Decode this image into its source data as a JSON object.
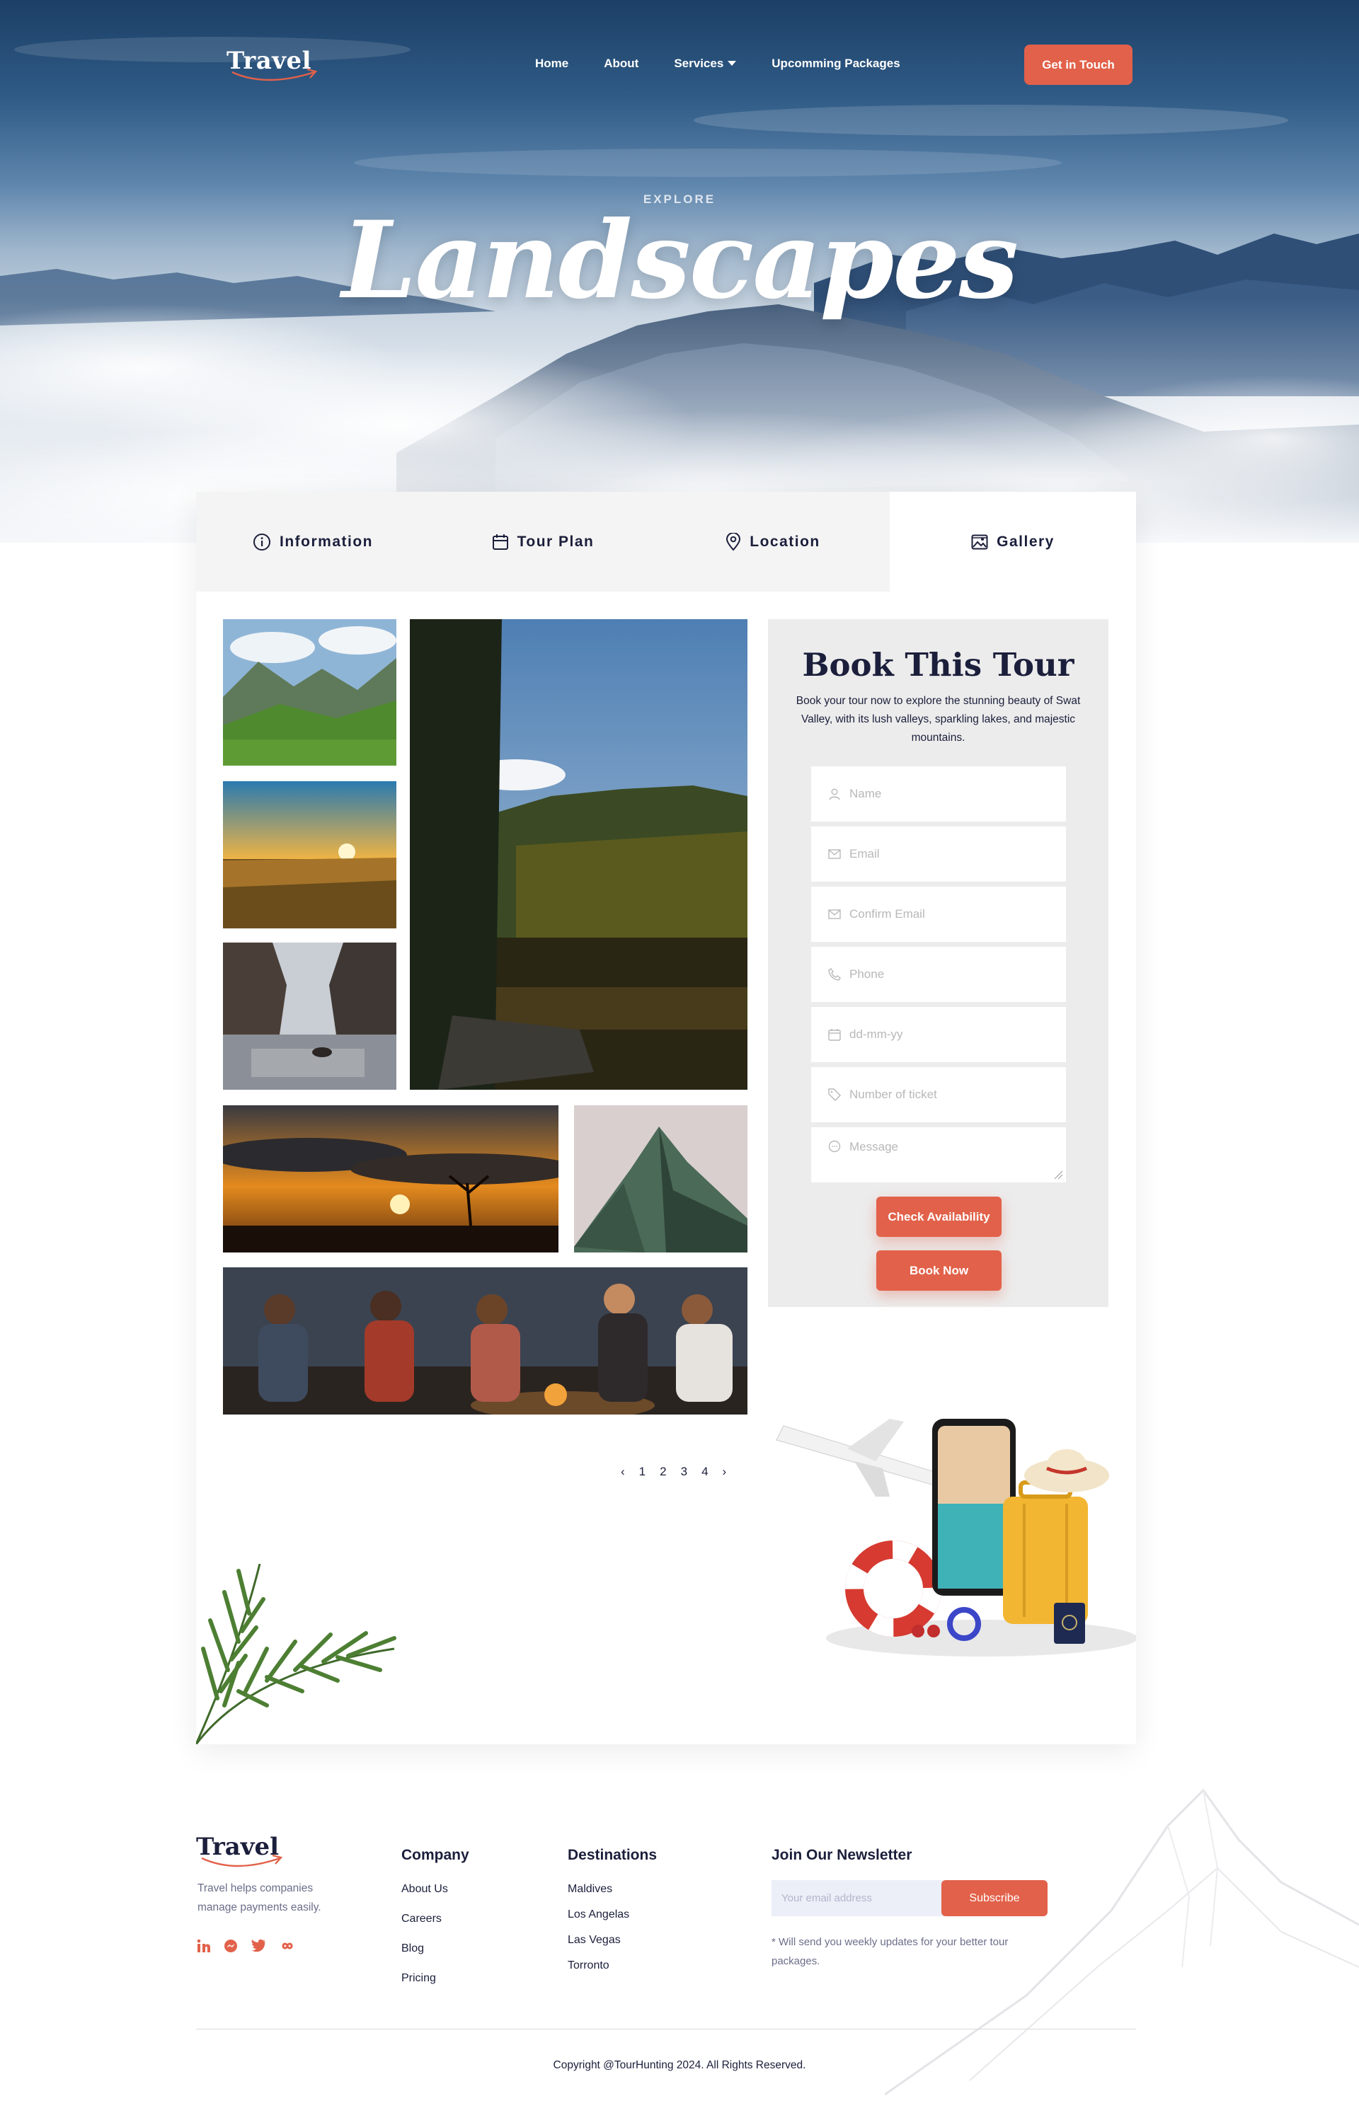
{
  "nav": {
    "logo": "Travel",
    "items": [
      "Home",
      "About",
      "Services",
      "Upcomming Packages"
    ],
    "cta": "Get in Touch"
  },
  "hero": {
    "eyebrow": "EXPLORE",
    "title": "Landscapes"
  },
  "tabs": [
    {
      "label": "Information",
      "icon": "info-icon"
    },
    {
      "label": "Tour Plan",
      "icon": "calendar-icon"
    },
    {
      "label": "Location",
      "icon": "location-pin-icon"
    },
    {
      "label": "Gallery",
      "icon": "image-icon"
    }
  ],
  "active_tab": "Gallery",
  "pagination": {
    "prev": "‹",
    "pages": [
      "1",
      "2",
      "3",
      "4"
    ],
    "next": "›"
  },
  "booking": {
    "title": "Book This Tour",
    "description": "Book your tour now to explore the stunning beauty of Swat Valley, with its lush valleys, sparkling lakes, and majestic mountains.",
    "fields": [
      {
        "placeholder": "Name",
        "icon": "user-icon"
      },
      {
        "placeholder": "Email",
        "icon": "mail-icon"
      },
      {
        "placeholder": "Confirm Email",
        "icon": "mail-icon"
      },
      {
        "placeholder": "Phone",
        "icon": "phone-icon"
      },
      {
        "placeholder": "dd-mm-yy",
        "icon": "calendar-icon"
      },
      {
        "placeholder": "Number of ticket",
        "icon": "tag-icon"
      },
      {
        "placeholder": "Message",
        "icon": "chat-icon"
      }
    ],
    "check_label": "Check Availability",
    "book_label": "Book Now"
  },
  "footer": {
    "logo": "Travel",
    "tagline": "Travel helps companies manage payments easily.",
    "social": [
      "linkedin-icon",
      "messenger-icon",
      "twitter-icon",
      "infinity-icon"
    ],
    "company": {
      "heading": "Company",
      "links": [
        "About Us",
        "Careers",
        "Blog",
        "Pricing"
      ]
    },
    "destinations": {
      "heading": "Destinations",
      "links": [
        "Maldives",
        "Los Angelas",
        "Las Vegas",
        "Torronto"
      ]
    },
    "newsletter": {
      "heading": "Join Our Newsletter",
      "placeholder": "Your email address",
      "button": "Subscribe",
      "note": "* Will send you weekly updates for your better tour packages."
    },
    "copyright": "Copyright @TourHunting 2024. All Rights Reserved."
  },
  "colors": {
    "accent": "#e2614a",
    "navy": "#1b1f3b",
    "panel": "#ececec",
    "tab_bg": "#f4f4f4"
  }
}
